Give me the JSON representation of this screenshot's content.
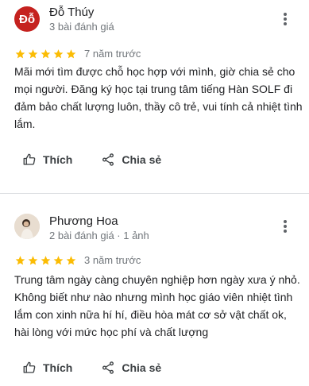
{
  "reviews": [
    {
      "avatar_letter": "Đỗ",
      "avatar_color": "#c5221f",
      "name": "Đỗ Thúy",
      "meta": "3 bài đánh giá",
      "stars": 5,
      "time": "7 năm trước",
      "text": "Mãi mới tìm được chỗ học hợp với mình, giờ chia sẻ cho mọi người. Đăng ký học tại trung tâm tiếng Hàn SOLF đi đảm bảo chất lượng luôn, thầy cô trẻ, vui tính cả nhiệt tình lắm.",
      "like_label": "Thích",
      "share_label": "Chia sẻ"
    },
    {
      "name": "Phương Hoa",
      "meta": "2 bài đánh giá · 1 ảnh",
      "stars": 5,
      "time": "3 năm trước",
      "text": "Trung tâm ngày càng chuyên nghiệp hơn ngày xưa ý nhỏ. Không biết như nào nhưng mình học giáo viên nhiệt tình lắm con xinh nữa hí hí, điều hòa mát cơ sở vật chất ok, hài lòng với mức học phí và chất lượng",
      "like_label": "Thích",
      "share_label": "Chia sẻ"
    }
  ],
  "colors": {
    "star": "#fbbc04",
    "text": "#202124",
    "secondary": "#70757a",
    "divider": "#dadce0"
  },
  "icons": {
    "more": "more-vert-icon",
    "like": "thumb-up-icon",
    "share": "share-icon",
    "star": "star-icon"
  }
}
